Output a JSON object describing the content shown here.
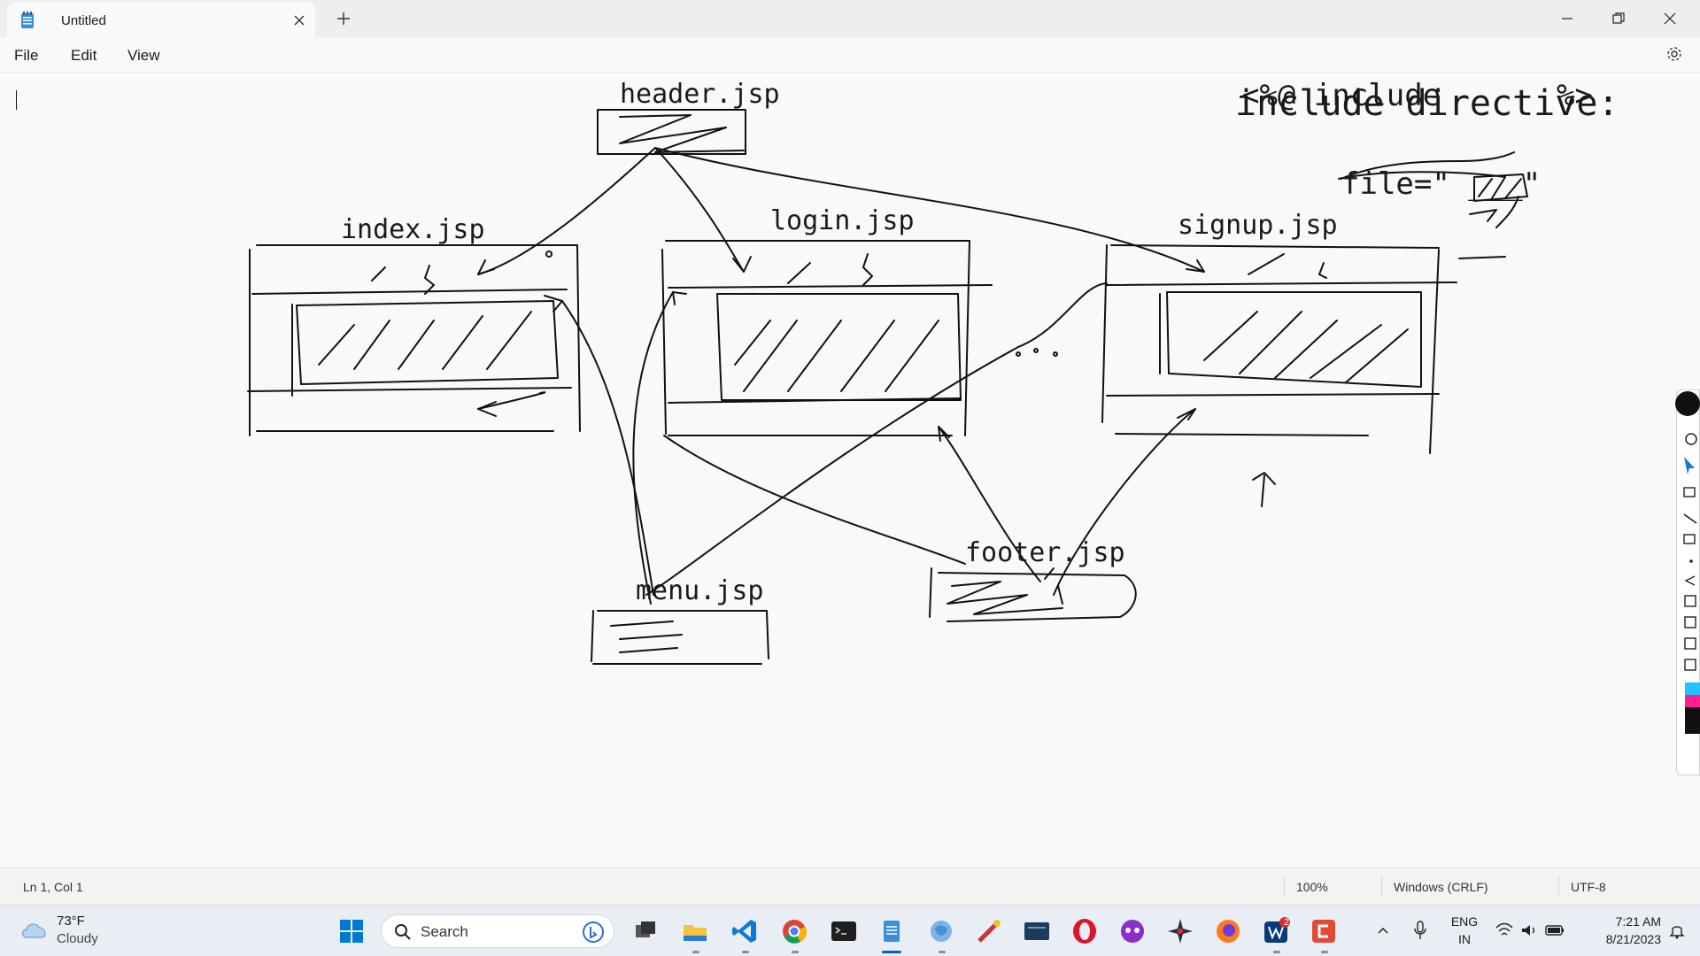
{
  "window": {
    "tab_title": "Untitled",
    "icons": {
      "app": "notepad-icon",
      "close_tab": "close-icon",
      "new_tab": "plus-icon",
      "minimize": "minimize-icon",
      "maximize": "restore-icon",
      "close": "close-icon"
    }
  },
  "menu": {
    "file": "File",
    "edit": "Edit",
    "view": "View",
    "settings_icon": "gear-icon"
  },
  "drawing": {
    "labels": {
      "header": "header.jsp",
      "index": "index.jsp",
      "login": "login.jsp",
      "signup": "signup.jsp",
      "menu": "menu.jsp",
      "footer": "footer.jsp",
      "title": "include directive:",
      "syntax": "<%@ include",
      "syntax_end": "%>",
      "file_attr": "file=\" ___\""
    }
  },
  "status": {
    "position": "Ln 1, Col 1",
    "zoom": "100%",
    "line_ending": "Windows (CRLF)",
    "encoding": "UTF-8"
  },
  "taskbar": {
    "weather_temp": "73°F",
    "weather_cond": "Cloudy",
    "search_placeholder": "Search",
    "apps": [
      "start-icon",
      "bing-icon",
      "task-view-icon",
      "file-explorer-icon",
      "vscode-icon",
      "chrome-icon",
      "terminal-icon",
      "notepad-icon",
      "app-icon",
      "app-icon",
      "app-icon",
      "opera-icon",
      "app-icon",
      "app-icon",
      "firefox-icon",
      "app-icon",
      "app-icon"
    ],
    "lang_top": "ENG",
    "lang_bottom": "IN",
    "time": "7:21 AM",
    "date": "8/21/2023",
    "badge_count": "2"
  },
  "colors": {
    "ink": "#111111",
    "taskbar": "#e9eef5",
    "accent": "#0067c0"
  }
}
